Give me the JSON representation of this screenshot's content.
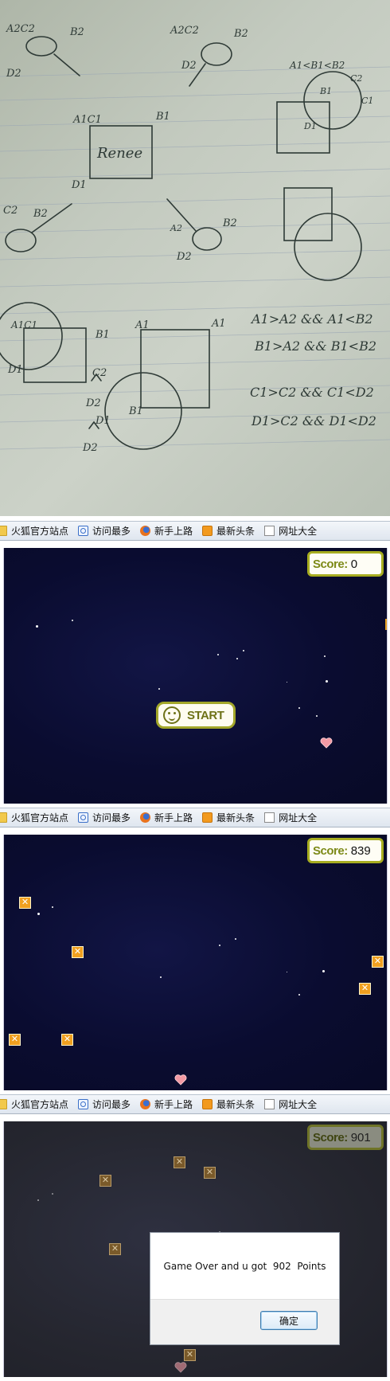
{
  "notebook": {
    "sketch_labels": [
      "A2C2",
      "B2",
      "D2",
      "A2C2",
      "B2",
      "D2",
      "A1<B1<B2",
      "C2",
      "C1",
      "B1",
      "D1",
      "A1C1",
      "B1",
      "Renee",
      "D1",
      "C2",
      "B2",
      "A2",
      "B2",
      "D2",
      "A1C1",
      "B1",
      "D1",
      "A1",
      "A1",
      "B1",
      "D1",
      "C2",
      "D2",
      "D2",
      "A1>A2 && A1<B2",
      "B1>A2 && B1<B2",
      "C1>C2 && C1<D2",
      "D1>C2 && D1<D2"
    ]
  },
  "bookmarks": [
    {
      "label": "火狐官方站点",
      "icon": "folder-icon"
    },
    {
      "label": "访问最多",
      "icon": "search-icon"
    },
    {
      "label": "新手上路",
      "icon": "firefox-icon"
    },
    {
      "label": "最新头条",
      "icon": "rss-icon"
    },
    {
      "label": "网址大全",
      "icon": "page-icon"
    }
  ],
  "game1": {
    "score_label": "Score:",
    "score_value": "0",
    "start_label": "START"
  },
  "game2": {
    "score_label": "Score:",
    "score_value": "839",
    "block_glyph": "✕"
  },
  "game3": {
    "score_label": "Score:",
    "score_value": "901",
    "block_glyph": "✕",
    "dialog_message": "Game Over and u got  902  Points",
    "dialog_ok": "确定"
  },
  "colors": {
    "space": "#0a0c30",
    "score_border": "#a7ad20",
    "block": "#f0a020",
    "heart": "#f39aa4"
  }
}
